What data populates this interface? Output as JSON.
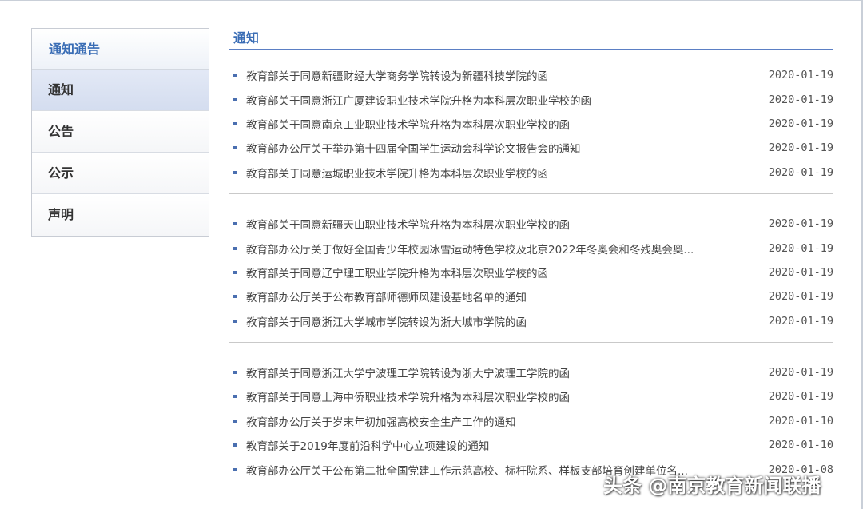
{
  "sidebar": {
    "title": "通知通告",
    "items": [
      {
        "label": "通知",
        "active": true
      },
      {
        "label": "公告",
        "active": false
      },
      {
        "label": "公示",
        "active": false
      },
      {
        "label": "声明",
        "active": false
      }
    ]
  },
  "main": {
    "title": "通知",
    "groups": [
      [
        {
          "title": "教育部关于同意新疆财经大学商务学院转设为新疆科技学院的函",
          "date": "2020-01-19"
        },
        {
          "title": "教育部关于同意浙江广厦建设职业技术学院升格为本科层次职业学校的函",
          "date": "2020-01-19"
        },
        {
          "title": "教育部关于同意南京工业职业技术学院升格为本科层次职业学校的函",
          "date": "2020-01-19"
        },
        {
          "title": "教育部办公厅关于举办第十四届全国学生运动会科学论文报告会的通知",
          "date": "2020-01-19"
        },
        {
          "title": "教育部关于同意运城职业技术学院升格为本科层次职业学校的函",
          "date": "2020-01-19"
        }
      ],
      [
        {
          "title": "教育部关于同意新疆天山职业技术学院升格为本科层次职业学校的函",
          "date": "2020-01-19"
        },
        {
          "title": "教育部办公厅关于做好全国青少年校园冰雪运动特色学校及北京2022年冬奥会和冬残奥会奥...",
          "date": "2020-01-19"
        },
        {
          "title": "教育部关于同意辽宁理工职业学院升格为本科层次职业学校的函",
          "date": "2020-01-19"
        },
        {
          "title": "教育部办公厅关于公布教育部师德师风建设基地名单的通知",
          "date": "2020-01-19"
        },
        {
          "title": "教育部关于同意浙江大学城市学院转设为浙大城市学院的函",
          "date": "2020-01-19"
        }
      ],
      [
        {
          "title": "教育部关于同意浙江大学宁波理工学院转设为浙大宁波理工学院的函",
          "date": "2020-01-19"
        },
        {
          "title": "教育部关于同意上海中侨职业技术学院升格为本科层次职业学校的函",
          "date": "2020-01-19"
        },
        {
          "title": "教育部办公厅关于岁末年初加强高校安全生产工作的通知",
          "date": "2020-01-10"
        },
        {
          "title": "教育部关于2019年度前沿科学中心立项建设的通知",
          "date": "2020-01-10"
        },
        {
          "title": "教育部办公厅关于公布第二批全国党建工作示范高校、标杆院系、样板支部培育创建单位名...",
          "date": "2020-01-08"
        }
      ]
    ]
  },
  "watermark": "头条 @南京教育新闻联播",
  "colors": {
    "accent": "#3a6db5",
    "active_bg": "#d9e1f2",
    "bullet": "#4a6fb0"
  }
}
